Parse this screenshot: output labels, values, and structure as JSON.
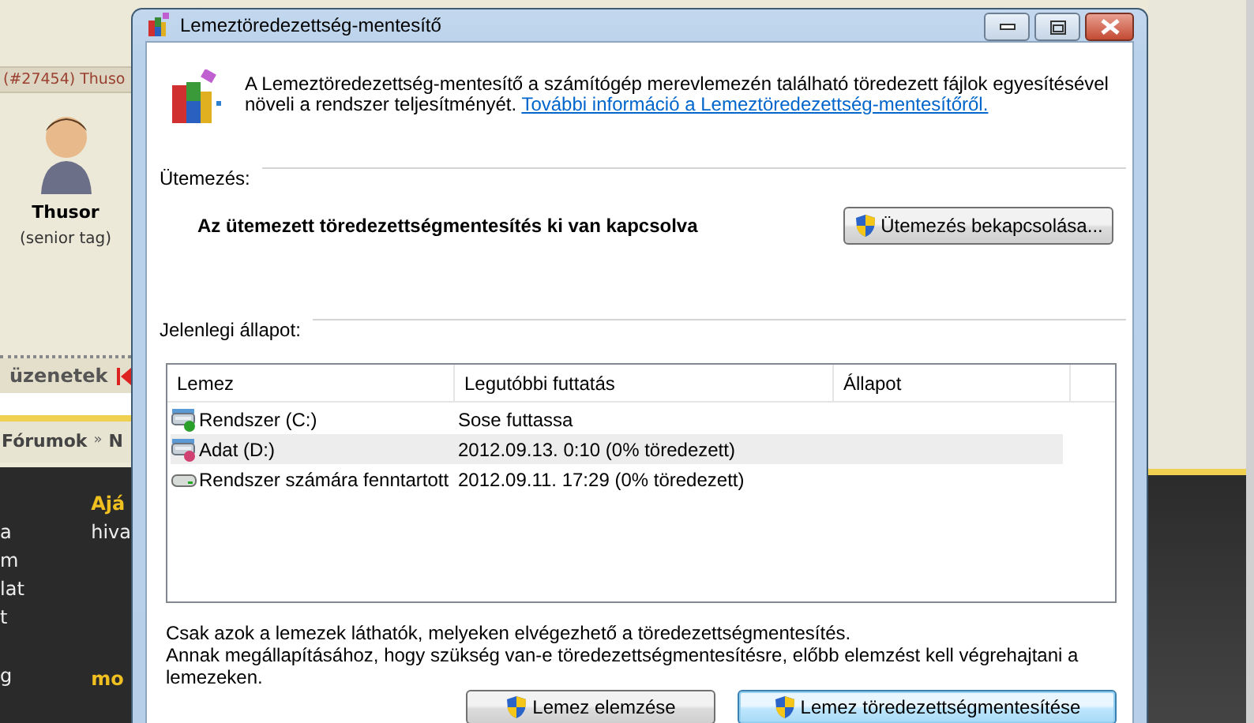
{
  "background_page": {
    "post_header": "(#27454) Thuso",
    "user_name": "Thusor",
    "user_rank": "(senior tag)",
    "nav_label": "üzenetek",
    "breadcrumb": "Fórumok",
    "breadcrumb_separator": "»",
    "breadcrumb_next": "N",
    "panel_heading": "Ajá",
    "panel_text": "hiva",
    "panel_bottom": "mo",
    "left_links": [
      "a",
      "m",
      "lat",
      "t"
    ],
    "left_bottom": "g"
  },
  "window": {
    "title": "Lemeztöredezettség-mentesítő",
    "intro_lines": [
      "A Lemeztöredezettség-mentesítő a számítógép merevlemezén található töredezett fájlok egyesítésével",
      "növeli a rendszer teljesítményét."
    ],
    "intro_link": "További információ a Lemeztöredezettség-mentesítőről.",
    "schedule": {
      "heading": "Ütemezés:",
      "status": "Az ütemezett töredezettségmentesítés ki van kapcsolva",
      "button": "Ütemezés bekapcsolása..."
    },
    "current_state": {
      "heading": "Jelenlegi állapot:",
      "columns": [
        "Lemez",
        "Legutóbbi futtatás",
        "Állapot"
      ],
      "rows": [
        {
          "kind": "system",
          "disk": "Rendszer (C:)",
          "last_run": "Sose futtassa",
          "selected": false
        },
        {
          "kind": "data",
          "disk": "Adat (D:)",
          "last_run": "2012.09.13. 0:10 (0% töredezett)",
          "selected": true
        },
        {
          "kind": "reserved",
          "disk": "Rendszer számára fenntartott",
          "last_run": "2012.09.11. 17:29 (0% töredezett)",
          "selected": false
        }
      ]
    },
    "notes": [
      "Csak azok a lemezek láthatók, melyeken elvégezhető a töredezettségmentesítés.",
      "Annak megállapításához, hogy szükség van-e töredezettségmentesítésre, előbb elemzést kell végrehajtani a lemezeken."
    ],
    "buttons": [
      {
        "label": "Lemez elemzése",
        "default": false
      },
      {
        "label": "Lemez töredezettségmentesítése",
        "default": true
      }
    ]
  }
}
